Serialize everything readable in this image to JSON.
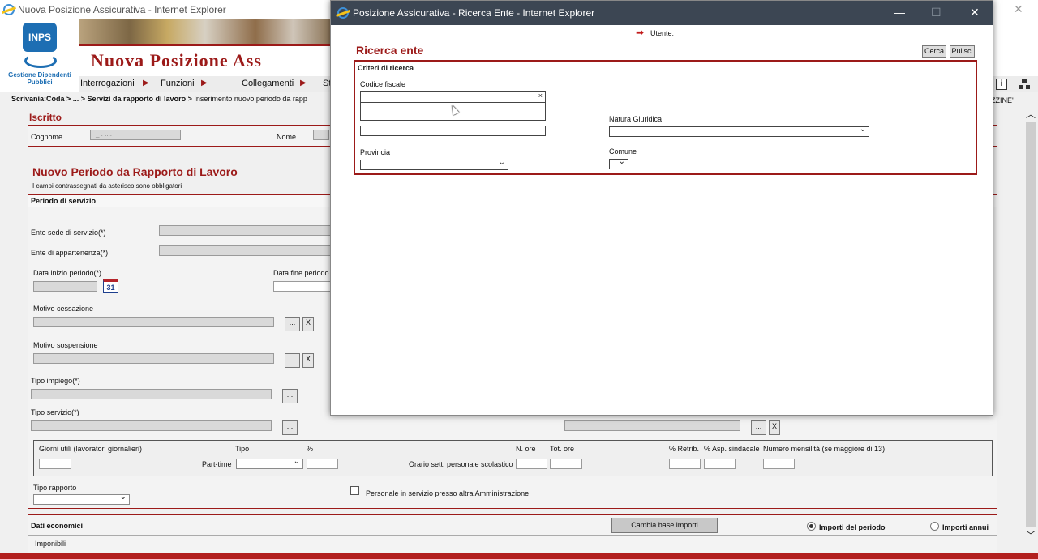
{
  "main_window": {
    "title": "Nuova Posizione Assicurativa - Internet Explorer",
    "close": "✕"
  },
  "header": {
    "logo_text": "INPS",
    "logo_sub": "Gestione Dipendenti Pubblici",
    "app_title": "Nuova Posizione Ass",
    "menu": [
      "Interrogazioni",
      "Funzioni",
      "Collegamenti",
      "St"
    ],
    "menu_arrow": "▶",
    "info_icon": "i",
    "ellipsis": "ZZINE'"
  },
  "breadcrumb": {
    "bold": "Scrivania:Coda > ... > Servizi da rapporto di lavoro >",
    "rest": " Inserimento nuovo periodo da rapp"
  },
  "iscritto": {
    "title": "Iscritto",
    "cognome_label": "Cognome",
    "cognome_value": "_ . ....",
    "nome_label": "Nome"
  },
  "periodo": {
    "title": "Nuovo Periodo da Rapporto di Lavoro",
    "note": "I campi contrassegnati da asterisco sono obbligatori",
    "section": "Periodo di servizio",
    "ente_sede": "Ente sede di servizio(*)",
    "ente_app": "Ente di appartenenza(*)",
    "data_inizio": "Data inizio periodo(*)",
    "cal": "31",
    "data_fine": "Data fine periodo",
    "motivo_cess": "Motivo cessazione",
    "motivo_sosp": "Motivo sospensione",
    "tipo_impiego": "Tipo impiego(*)",
    "tipo_servizio": "Tipo servizio(*)",
    "dots": "...",
    "x": "X",
    "giorni": "Giorni utili (lavoratori giornalieri)",
    "tipo": "Tipo",
    "pct": "%",
    "part_time": "Part-time",
    "orario": "Orario sett. personale scolastico",
    "n_ore": "N. ore",
    "tot_ore": "Tot. ore",
    "pct_retrib": "% Retrib.",
    "pct_asp": "% Asp. sindacale",
    "num_mens": "Numero mensilità (se maggiore di 13)",
    "tipo_rapporto": "Tipo rapporto",
    "personale": "Personale in servizio presso altra Amministrazione"
  },
  "economici": {
    "title": "Dati economici",
    "cambia": "Cambia base importi",
    "importi_periodo": "Importi del periodo",
    "importi_annui": "Importi annui",
    "imponibili": "Imponibili"
  },
  "popup": {
    "title": "Posizione Assicurativa - Ricerca Ente - Internet Explorer",
    "utente": "Utente:",
    "heading": "Ricerca ente",
    "cerca": "Cerca",
    "pulisci": "Pulisci",
    "criteri": "Criteri di ricerca",
    "codice_fiscale": "Codice fiscale",
    "clear_x": "×",
    "natura": "Natura Giuridica",
    "provincia": "Provincia",
    "comune": "Comune",
    "min": "—",
    "max": "☐",
    "close": "✕"
  },
  "colors": {
    "brand_red": "#9c1a19",
    "title_bar": "#3c4653",
    "inps_blue": "#1d6eb3"
  }
}
